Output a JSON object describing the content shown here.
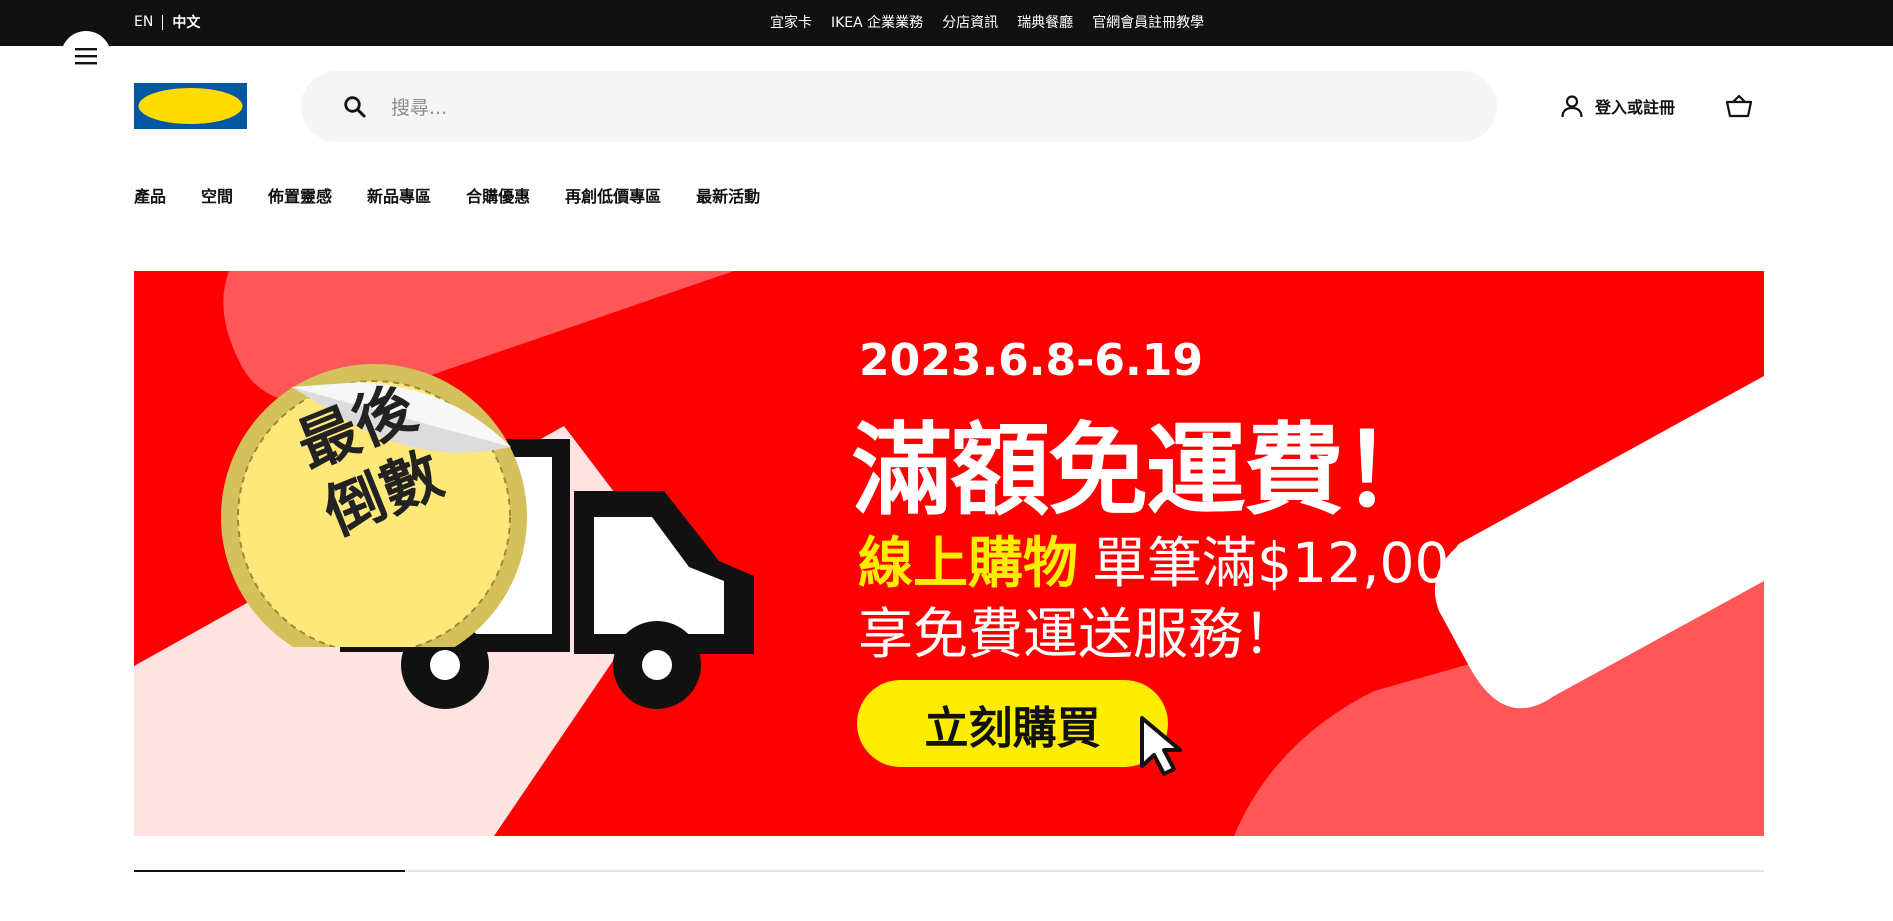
{
  "topbar": {
    "lang_en": "EN",
    "lang_zh": "中文",
    "links": [
      "宜家卡",
      "IKEA 企業業務",
      "分店資訊",
      "瑞典餐廳",
      "官網會員註冊教學"
    ]
  },
  "header": {
    "logo_text": "IKEA",
    "search_placeholder": "搜尋...",
    "account_label": "登入或註冊"
  },
  "nav": {
    "items": [
      "產品",
      "空間",
      "佈置靈感",
      "新品專區",
      "合購優惠",
      "再創低價專區",
      "最新活動"
    ]
  },
  "banner": {
    "date": "2023.6.8-6.19",
    "headline": "滿額免運費！",
    "line3_highlight": "線上購物",
    "line3_rest": "單筆滿$12,000",
    "line4": "享免費運送服務！",
    "cta": "立刻購買",
    "sticker_line1": "最後",
    "sticker_line2": "倒數"
  },
  "carousel": {
    "progress": 0.166
  },
  "colors": {
    "topbar": "#111111",
    "ikea_blue": "#0058a3",
    "ikea_yellow": "#ffdb00",
    "banner_red": "#ff0000",
    "cta_yellow": "#ffed00"
  }
}
